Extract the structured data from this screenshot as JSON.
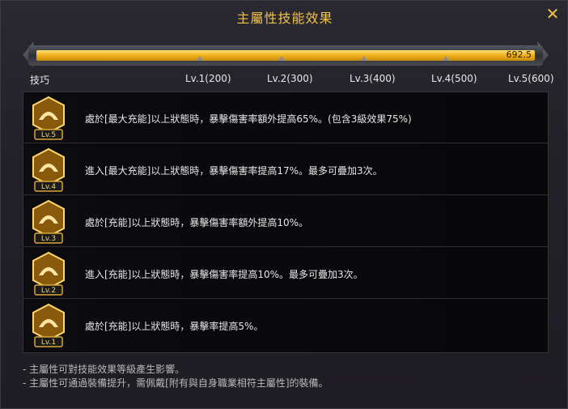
{
  "window": {
    "title": "主屬性技能效果",
    "close_glyph": "✕"
  },
  "progress": {
    "value_text": "692.5",
    "current": 692.5,
    "max": 692.5,
    "fill_fraction": 1.0,
    "thresholds": [
      200,
      300,
      400,
      500,
      600
    ]
  },
  "levels": {
    "start_label": "技巧",
    "items": [
      "Lv.1(200)",
      "Lv.2(300)",
      "Lv.3(400)",
      "Lv.4(500)",
      "Lv.5(600)"
    ]
  },
  "effects": [
    {
      "badge": "Lv.5",
      "text": "處於[最大充能]以上狀態時，暴擊傷害率額外提高65%。(包含3級效果75%)"
    },
    {
      "badge": "Lv.4",
      "text": "進入[最大充能]以上狀態時，暴擊傷害率提高17%。最多可疊加3次。"
    },
    {
      "badge": "Lv.3",
      "text": "處於[充能]以上狀態時，暴擊傷害率額外提高10%。"
    },
    {
      "badge": "Lv.2",
      "text": "進入[充能]以上狀態時，暴擊傷害率提高10%。最多可疊加3次。"
    },
    {
      "badge": "Lv.1",
      "text": "處於[充能]以上狀態時，暴擊率提高5%。"
    }
  ],
  "footnotes": [
    "- 主屬性可對技能效果等級產生影響。",
    "- 主屬性可通過裝備提升，需佩戴[附有與自身職業相符主屬性]的裝備。"
  ],
  "colors": {
    "accent_gold": "#f1c24a",
    "bar_fill": "#f3b41e"
  },
  "icons": {
    "close": "close-icon",
    "badge": "gold-emblem-icon"
  }
}
